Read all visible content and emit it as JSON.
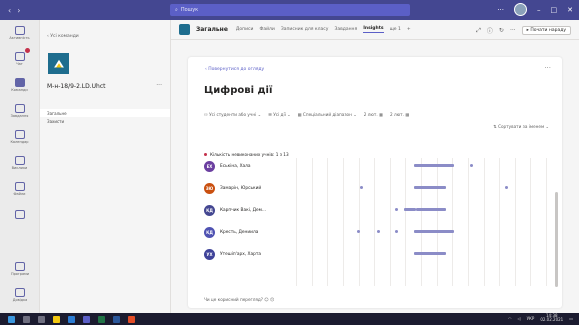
{
  "titlebar": {
    "search_placeholder": "Пошук",
    "win_min": "–",
    "win_max": "□",
    "win_close": "✕"
  },
  "rail": {
    "items": [
      {
        "label": "Активність",
        "icon": "bell-icon"
      },
      {
        "label": "Чат",
        "icon": "chat-icon"
      },
      {
        "label": "Команди",
        "icon": "teams-icon"
      },
      {
        "label": "Завдання",
        "icon": "assignments-icon"
      },
      {
        "label": "Календар",
        "icon": "calendar-icon"
      },
      {
        "label": "Виклики",
        "icon": "calls-icon"
      },
      {
        "label": "Файли",
        "icon": "files-icon"
      },
      {
        "label": "",
        "icon": "more-icon"
      }
    ],
    "bottom": [
      {
        "label": "Програми",
        "icon": "apps-icon"
      },
      {
        "label": "Довідка",
        "icon": "help-icon"
      }
    ]
  },
  "channels": {
    "back_label": "‹ Усі команди",
    "team_name": "М-н-18/9-2.LD.Uhct",
    "more": "···",
    "items": [
      "Загальне",
      "Захисти"
    ]
  },
  "tabs": {
    "channel_title": "Загальне",
    "items": [
      "Дописи",
      "Файли",
      "Записник для класу",
      "Завдання",
      "Insights",
      "ще 1"
    ],
    "active_index": 4,
    "add": "+",
    "meet_label": "Почати нараду"
  },
  "card": {
    "back_label": "‹ Повернутися до огляду",
    "more": "···",
    "title": "Цифрові дії",
    "filters": [
      "Усі студенти або учні",
      "Усі дії",
      "Спеціальний діапазон",
      "2 лют.",
      "2 лют."
    ],
    "sort_label": "Сортувати за іменем",
    "legend_label": "Кількість невиконаних учнів: 1 з 13",
    "feedback_label": "Чи це корисний перегляд?"
  },
  "students": [
    {
      "initials": "ЕХ",
      "name": "Еськіна, Хала",
      "color": "#6b3fa0"
    },
    {
      "initials": "ЗЮ",
      "name": "Замарін, Юрський",
      "color": "#ca5010"
    },
    {
      "initials": "КД",
      "name": "Карпчик Вакі, Дем...",
      "color": "#444791"
    },
    {
      "initials": "КД",
      "name": "Кресть, Дениила",
      "color": "#4f52b2"
    },
    {
      "initials": "УХ",
      "name": "Утешіп'арх, Харта",
      "color": "#3f4399"
    }
  ],
  "activity": [
    {
      "bars": [
        [
          0.47,
          0.63
        ]
      ],
      "dots": [
        0.7
      ]
    },
    {
      "bars": [
        [
          0.47,
          0.6
        ]
      ],
      "dots": [
        0.26,
        0.84
      ]
    },
    {
      "bars": [
        [
          0.43,
          0.48
        ],
        [
          0.48,
          0.6
        ]
      ],
      "dots": [
        0.4
      ]
    },
    {
      "bars": [
        [
          0.47,
          0.63
        ]
      ],
      "dots": [
        0.25,
        0.33,
        0.4
      ]
    },
    {
      "bars": [
        [
          0.47,
          0.6
        ]
      ],
      "dots": []
    }
  ],
  "taskbar": {
    "lang": "УКР",
    "time": "14:38",
    "date": "02.02.2021"
  }
}
